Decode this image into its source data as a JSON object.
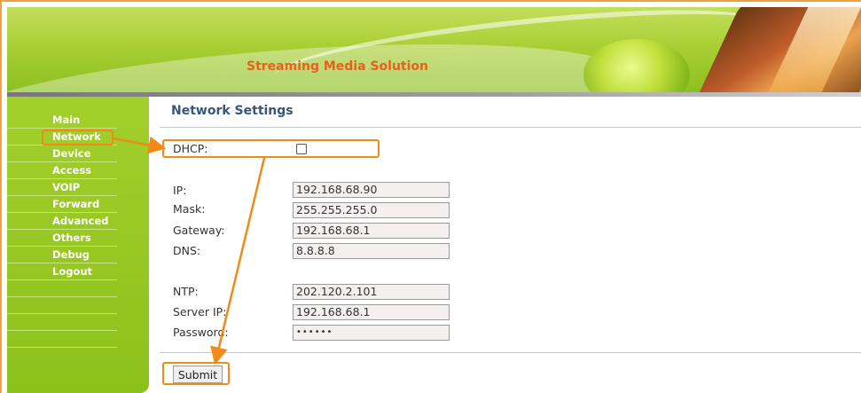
{
  "header": {
    "title": "Streaming Media Solution"
  },
  "sidebar": {
    "items": [
      {
        "label": "Main"
      },
      {
        "label": "Network"
      },
      {
        "label": "Device"
      },
      {
        "label": "Access"
      },
      {
        "label": "VOIP"
      },
      {
        "label": "Forward"
      },
      {
        "label": "Advanced"
      },
      {
        "label": "Others"
      },
      {
        "label": "Debug"
      },
      {
        "label": "Logout"
      }
    ]
  },
  "main": {
    "title": "Network Settings",
    "dhcp": {
      "label": "DHCP:",
      "checked": false
    },
    "ip": {
      "label": "IP:",
      "value": "192.168.68.90"
    },
    "mask": {
      "label": "Mask:",
      "value": "255.255.255.0"
    },
    "gateway": {
      "label": "Gateway:",
      "value": "192.168.68.1"
    },
    "dns": {
      "label": "DNS:",
      "value": "8.8.8.8"
    },
    "ntp": {
      "label": "NTP:",
      "value": "202.120.2.101"
    },
    "server_ip": {
      "label": "Server IP:",
      "value": "192.168.68.1"
    },
    "password": {
      "label": "Password:",
      "value": "••••••"
    },
    "submit_label": "Submit"
  },
  "colors": {
    "accent": "#8cc11c",
    "highlight": "#f08a18",
    "title": "#35567a",
    "banner_text": "#e8601c"
  }
}
